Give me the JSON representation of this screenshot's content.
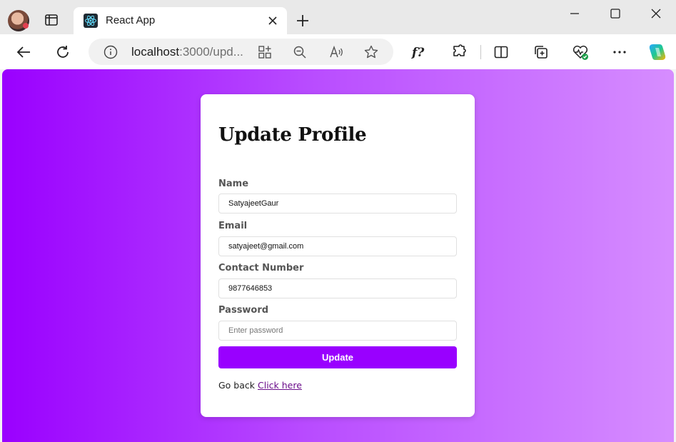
{
  "browser": {
    "tab_title": "React App",
    "url_host": "localhost",
    "url_rest": ":3000/upd...",
    "icons": [
      "profile-avatar",
      "tab-actions-icon",
      "react-favicon",
      "close-icon",
      "plus-icon",
      "minimize-icon",
      "maximize-icon",
      "window-close-icon",
      "back-icon",
      "refresh-icon",
      "info-icon",
      "app-grid-icon",
      "zoom-out-icon",
      "read-aloud-icon",
      "favorite-star-icon",
      "formula-icon",
      "extensions-icon",
      "split-screen-icon",
      "collections-icon",
      "browser-essentials-icon",
      "more-icon",
      "copilot-icon"
    ]
  },
  "form": {
    "title": "Update Profile",
    "fields": [
      {
        "label": "Name",
        "value": "SatyajeetGaur",
        "placeholder": ""
      },
      {
        "label": "Email",
        "value": "satyajeet@gmail.com",
        "placeholder": ""
      },
      {
        "label": "Contact Number",
        "value": "9877646853",
        "placeholder": ""
      },
      {
        "label": "Password",
        "value": "",
        "placeholder": "Enter password"
      }
    ],
    "submit_label": "Update",
    "goback_text": "Go back",
    "goback_link": "Click here"
  },
  "colors": {
    "accent": "#9900ff",
    "gradient_start": "#9a00ff",
    "gradient_end": "#d68dff"
  }
}
